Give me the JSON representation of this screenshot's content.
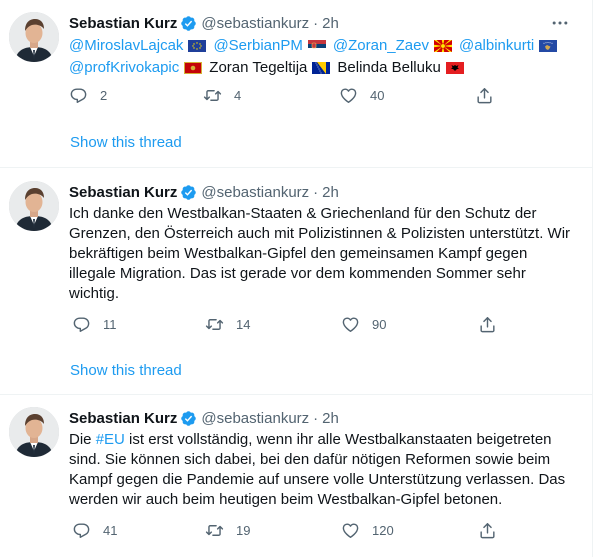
{
  "tweets": [
    {
      "author": "Sebastian Kurz",
      "handle": "@sebastiankurz",
      "separator": "·",
      "time": "2h",
      "mentions_line1": [
        {
          "text": "@MiroslavLajcak",
          "flag": "eu"
        },
        {
          "text": "@SerbianPM",
          "flag": "serbia"
        },
        {
          "text": "@Zoran_Zaev",
          "flag": "north-macedonia"
        },
        {
          "text": "@albinkurti",
          "flag": "kosovo"
        }
      ],
      "mentions_line2": [
        {
          "text": "@profKrivokapic",
          "flag": "montenegro"
        },
        {
          "text": "Zoran Tegeltija",
          "flag": "bosnia"
        },
        {
          "text": "Belinda Belluku",
          "flag": "albania"
        }
      ],
      "replies": "2",
      "retweets": "4",
      "likes": "40",
      "show_thread": "Show this thread"
    },
    {
      "author": "Sebastian Kurz",
      "handle": "@sebastiankurz",
      "separator": "·",
      "time": "2h",
      "text": "Ich danke den Westbalkan-Staaten & Griechenland für den Schutz der\nGrenzen, den Österreich auch mit Polizistinnen & Polizisten unterstützt. Wir\nbekräftigen beim Westbalkan-Gipfel den gemeinsamen Kampf gegen\nillegale Migration. Das ist gerade vor dem kommenden Sommer sehr\nwichtig.",
      "replies": "11",
      "retweets": "14",
      "likes": "90",
      "show_thread": "Show this thread"
    },
    {
      "author": "Sebastian Kurz",
      "handle": "@sebastiankurz",
      "separator": "·",
      "time": "2h",
      "text_prefix": "Die ",
      "hashtag": "#EU",
      "text_rest": " ist erst vollständig, wenn ihr alle Westbalkanstaaten beigetreten\nsind. Sie können sich dabei, bei den dafür nötigen Reformen sowie beim\nKampf gegen die Pandemie auf unsere volle Unterstützung verlassen. Das\nwerden wir auch beim heutigen beim Westbalkan-Gipfel betonen.",
      "replies": "41",
      "retweets": "19",
      "likes": "120"
    }
  ],
  "colors": {
    "link": "#1d9bf0",
    "text": "#0f1419",
    "muted": "#536471",
    "divider": "#eff3f4"
  },
  "icons": [
    "verified-badge-icon",
    "more-icon",
    "reply-icon",
    "retweet-icon",
    "like-icon",
    "share-icon"
  ]
}
